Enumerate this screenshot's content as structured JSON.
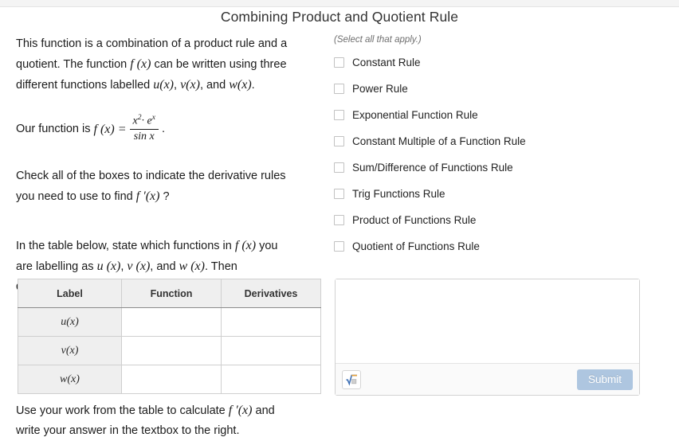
{
  "header": {
    "title": "Combining Product and Quotient Rule"
  },
  "left": {
    "intro_line1": "This function is a combination of a product rule and a",
    "intro_line2a": "quotient.  The function",
    "intro_fx": "f (x)",
    "intro_line2b": "can be written using three",
    "intro_line3a": "different functions labelled",
    "intro_u": "u(x)",
    "intro_comma1": ",",
    "intro_v": "v(x)",
    "intro_and": ", and",
    "intro_w": "w(x)",
    "intro_period": ".",
    "function_label": "Our function is",
    "function_fx": "f (x) =",
    "function_numerator": "x",
    "function_numerator_exp": "2",
    "function_numerator_rest": "· e",
    "function_numerator_rest_exp": "x",
    "function_denominator": "sin x",
    "function_trailing": ".",
    "check_line1": "Check all of the boxes to indicate the derivative rules",
    "check_line2a": "you need to use to find",
    "check_fprime": "f ′(x)",
    "check_line2b": "?",
    "table_line1a": "In the table below, state which functions in",
    "table_fx": "f (x)",
    "table_line1b": "you",
    "table_line2a": "are labelling as",
    "table_u": "u (x)",
    "table_comma1": ",",
    "table_v": "v (x)",
    "table_and": ", and",
    "table_w": "w (x)",
    "table_line2b": ".  Then",
    "table_line3": "determine their derivatives.",
    "bottom_line1a": "Use your work from the table to calculate",
    "bottom_fprime": "f ′(x)",
    "bottom_line1b": "and",
    "bottom_line2": "write your answer in the textbox to the right."
  },
  "table": {
    "headers": [
      "Label",
      "Function",
      "Derivatives"
    ],
    "rows": [
      {
        "label": "u(x)",
        "function": "",
        "derivative": ""
      },
      {
        "label": "v(x)",
        "function": "",
        "derivative": ""
      },
      {
        "label": "w(x)",
        "function": "",
        "derivative": ""
      }
    ]
  },
  "rules": {
    "hint": "(Select all that apply.)",
    "options": [
      {
        "label": "Constant Rule",
        "checked": false
      },
      {
        "label": "Power Rule",
        "checked": false
      },
      {
        "label": "Exponential Function Rule",
        "checked": false
      },
      {
        "label": "Constant Multiple of a Function Rule",
        "checked": false
      },
      {
        "label": "Sum/Difference of Functions Rule",
        "checked": false
      },
      {
        "label": "Trig Functions Rule",
        "checked": false
      },
      {
        "label": "Product of Functions Rule",
        "checked": false
      },
      {
        "label": "Quotient of Functions Rule",
        "checked": false
      }
    ]
  },
  "answer": {
    "value": "",
    "placeholder": "",
    "math_icon": "square-root-icon",
    "submit_label": "Submit"
  },
  "colors": {
    "submit_bg": "#aec6e0",
    "table_header_bg": "#efefef",
    "border": "#cfcfcf",
    "hint_text": "#6e6e6e"
  }
}
